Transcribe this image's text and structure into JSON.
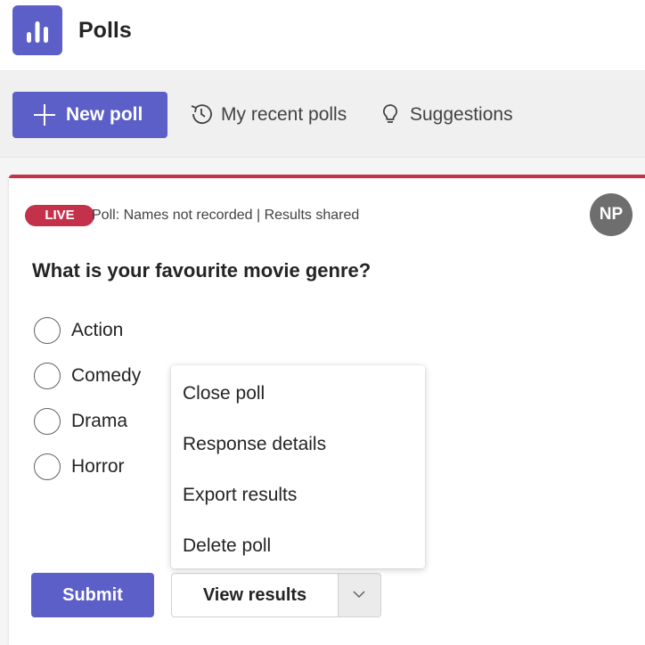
{
  "app": {
    "title": "Polls",
    "logo_icon": "poll-bars-icon",
    "brand_color": "#5b5fc7"
  },
  "toolbar": {
    "new_poll_label": "New poll",
    "new_poll_icon": "plus-icon",
    "recent_label": "My recent polls",
    "recent_icon": "history-icon",
    "suggestions_label": "Suggestions",
    "suggestions_icon": "lightbulb-icon"
  },
  "poll": {
    "status_badge": "LIVE",
    "status_color": "#c4314b",
    "meta": "Poll: Names not recorded | Results shared",
    "avatar_initials": "NP",
    "question": "What is your favourite movie genre?",
    "options": [
      {
        "label": "Action",
        "selected": false
      },
      {
        "label": "Comedy",
        "selected": false
      },
      {
        "label": "Drama",
        "selected": false
      },
      {
        "label": "Horror",
        "selected": false
      }
    ],
    "submit_label": "Submit",
    "view_results_label": "View results",
    "view_results_dropdown_icon": "chevron-down-icon"
  },
  "menu": {
    "items": [
      {
        "label": "Close poll"
      },
      {
        "label": "Response details"
      },
      {
        "label": "Export results"
      },
      {
        "label": "Delete poll"
      }
    ]
  }
}
